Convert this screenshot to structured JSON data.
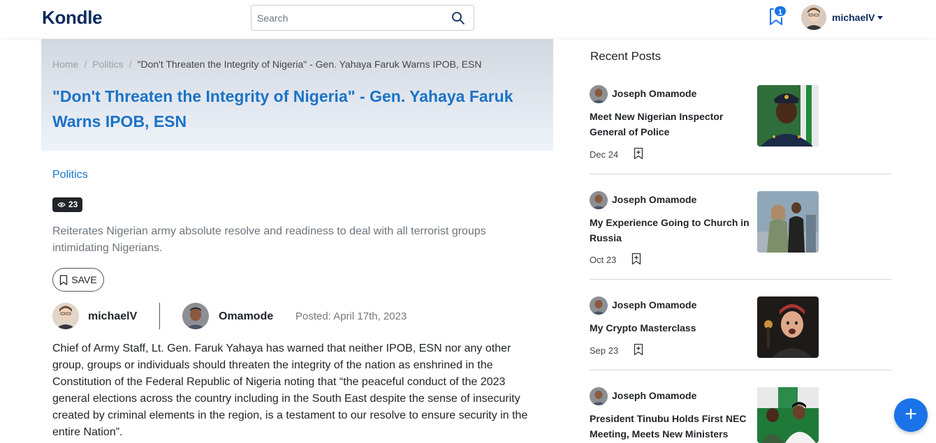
{
  "header": {
    "logo": "Kondle",
    "search_placeholder": "Search",
    "bookmark_count": "1",
    "username": "michaelV"
  },
  "breadcrumb": {
    "home": "Home",
    "category": "Politics",
    "current": "\"Don't Threaten the Integrity of Nigeria\" - Gen. Yahaya Faruk Warns IPOB, ESN"
  },
  "article": {
    "title": "\"Don't Threaten the Integrity of Nigeria\" - Gen. Yahaya Faruk Warns IPOB, ESN",
    "category": "Politics",
    "views": "23",
    "subtitle": "Reiterates Nigerian army absolute resolve and readiness to deal with all terrorist groups intimidating Nigerians.",
    "save_label": "SAVE",
    "viewer": "michaelV",
    "author": "Omamode",
    "posted": "Posted: April 17th, 2023",
    "body": "Chief of Army Staff, Lt. Gen. Faruk Yahaya has warned that neither IPOB, ESN nor any other group, groups or individuals should threaten the integrity of the nation as enshrined in the Constitution of the Federal Republic of Nigeria noting that “the peaceful conduct of the 2023 general elections across the country including in the South East despite the sense of insecurity created by criminal elements in the region, is a testament to our resolve to ensure security in the entire Nation”."
  },
  "sidebar": {
    "title": "Recent Posts",
    "posts": [
      {
        "author": "Joseph Omamode",
        "title": "Meet New Nigerian Inspector General of Police",
        "date": "Dec 24"
      },
      {
        "author": "Joseph Omamode",
        "title": "My Experience Going to Church in Russia",
        "date": "Oct 23"
      },
      {
        "author": "Joseph Omamode",
        "title": "My Crypto Masterclass",
        "date": "Sep 23"
      },
      {
        "author": "Joseph Omamode",
        "title": "President Tinubu Holds First NEC Meeting, Meets New Ministers",
        "date": ""
      }
    ]
  },
  "fab_label": "+",
  "colors": {
    "brand": "#0d2b5c",
    "accent": "#1a73c8",
    "fab": "#1a73e8"
  },
  "icons": [
    "search-icon",
    "bookmark-icon",
    "eye-icon",
    "chevron-down-icon",
    "plus-icon"
  ]
}
